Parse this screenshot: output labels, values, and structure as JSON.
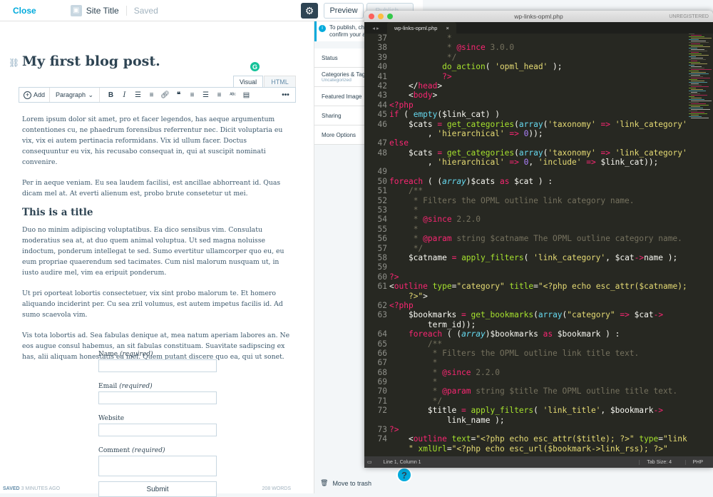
{
  "wp": {
    "close_label": "Close",
    "site_title": "Site Title",
    "saved_label": "Saved",
    "preview_label": "Preview",
    "publish_label": "Publish...",
    "post_title": "My first blog post.",
    "tab_visual": "Visual",
    "tab_html": "HTML",
    "toolbar": {
      "add_label": "Add",
      "paragraph_label": "Paragraph",
      "icons": [
        "bold-icon",
        "italic-icon",
        "unordered-list-icon",
        "ordered-list-icon",
        "link-icon",
        "quote-icon",
        "align-left-icon",
        "align-center-icon",
        "align-right-icon",
        "spellcheck-icon",
        "keyboard-icon",
        "more-icon"
      ]
    },
    "paragraphs": [
      "Lorem ipsum dolor sit amet, pro et facer legendos, has aeque argumentum contentiones cu, ne phaedrum forensibus referrentur nec. Dicit voluptaria eu vix, vix ei autem pertinacia reformidans. Vix id ullum facer. Doctus consequuntur eu vix, his recusabo consequat in, qui at suscipit nominati convenire.",
      "Per in aeque veniam. Eu sea laudem facilisi, est ancillae abhorreant id. Quas dicam mel at. At everti alienum est, probo brute consetetur ut mei."
    ],
    "heading": "This is a title",
    "paragraphs2": [
      "Duo no minim adipiscing voluptatibus. Ea dico sensibus vim. Consulatu moderatius sea at, at duo quem animal voluptua. Ut sed magna noluisse indoctum, ponderum intellegat te sed. Sumo evertitur ullamcorper quo eu, eu eum propriae quaerendum sed tacimates. Cum nisl malorum nusquam ut, in iusto audire mel, vim ea eripuit ponderum.",
      "Ut pri oporteat lobortis consectetuer, vix sint probo malorum te. Et homero aliquando inciderint per. Cu sea zril volumus, est autem impetus facilis id. Ad sumo scaevola vim.",
      "Vis tota lobortis ad. Sea fabulas denique at, mea natum aperiam labores an. Ne eos augue consul habemus, an sit fabulas constituam. Suavitate sadipscing ex has, alii aliquam honestatis ea mel. Quem putant discere quo ea, qui ut sonet."
    ],
    "form": {
      "name_label": "Name",
      "email_label": "Email",
      "website_label": "Website",
      "comment_label": "Comment",
      "required_text": "(required)",
      "submit_label": "Submit"
    },
    "status_saved": "SAVED",
    "status_time": "3 MINUTES AGO",
    "word_count": "208 WORDS",
    "sidebar": {
      "notice": "To publish, check\nconfirm your ad",
      "items": [
        {
          "label": "Status",
          "sub": ""
        },
        {
          "label": "Categories & Tags",
          "sub": "Uncategorized"
        },
        {
          "label": "Featured Image",
          "sub": ""
        },
        {
          "label": "Sharing",
          "sub": ""
        },
        {
          "label": "More Options",
          "sub": ""
        }
      ],
      "trash_label": "Move to trash",
      "help_label": "?"
    }
  },
  "sublime": {
    "file_name": "wp-links-opml.php",
    "unregistered": "UNREGISTERED",
    "tab_name": "wp-links-opml.php",
    "status_position": "Line 1, Column 1",
    "tab_size": "Tab Size: 4",
    "language": "PHP",
    "colors": {
      "bg": "#272822",
      "keyword": "#f92672",
      "function": "#a6e22e",
      "string": "#e6db74",
      "comment": "#75715e"
    },
    "lines": [
      {
        "n": "37",
        "html": "            <span class='c'>*</span>"
      },
      {
        "n": "38",
        "html": "            <span class='c'>* </span><span class='k'>@since</span><span class='c'> 3.0.0</span>"
      },
      {
        "n": "39",
        "html": "            <span class='c'>*/</span>"
      },
      {
        "n": "40",
        "html": "           <span class='f'>do_action</span>( <span class='s'>'opml_head'</span> );"
      },
      {
        "n": "41",
        "html": "           <span class='k'>?&gt;</span>"
      },
      {
        "n": "42",
        "html": "    &lt;/<span class='k'>head</span>&gt;"
      },
      {
        "n": "43",
        "html": "    &lt;<span class='k'>body</span>&gt;"
      },
      {
        "n": "44",
        "html": "<span class='k'>&lt;?php</span>"
      },
      {
        "n": "45",
        "html": "<span class='k'>if</span> ( <span class='t' style='font-style:normal;color:#66d9ef'>empty</span>($link_cat) )"
      },
      {
        "n": "46",
        "html": "    $cats <span class='k'>=</span> <span class='f'>get_categories</span>(<span class='t' style='font-style:normal;color:#66d9ef'>array</span>(<span class='s'>'taxonomy'</span> <span class='k'>=&gt;</span> <span class='s'>'link_category'</span>"
      },
      {
        "n": "",
        "html": "        , <span class='s'>'hierarchical'</span> <span class='k'>=&gt;</span> <span style='color:#ae81ff'>0</span>));"
      },
      {
        "n": "47",
        "html": "<span class='k'>else</span>"
      },
      {
        "n": "48",
        "html": "    $cats <span class='k'>=</span> <span class='f'>get_categories</span>(<span class='t' style='font-style:normal;color:#66d9ef'>array</span>(<span class='s'>'taxonomy'</span> <span class='k'>=&gt;</span> <span class='s'>'link_category'</span>"
      },
      {
        "n": "",
        "html": "        , <span class='s'>'hierarchical'</span> <span class='k'>=&gt;</span> <span style='color:#ae81ff'>0</span>, <span class='s'>'include'</span> <span class='k'>=&gt;</span> $link_cat));"
      },
      {
        "n": "49",
        "html": ""
      },
      {
        "n": "50",
        "html": "<span class='k'>foreach</span> ( (<span class='t'>array</span>)$cats <span class='k'>as</span> $cat ) :"
      },
      {
        "n": "51",
        "html": "    <span class='c'>/**</span>"
      },
      {
        "n": "52",
        "html": "     <span class='c'>* Filters the OPML outline link category name.</span>"
      },
      {
        "n": "53",
        "html": "     <span class='c'>*</span>"
      },
      {
        "n": "54",
        "html": "     <span class='c'>* </span><span class='k'>@since</span><span class='c'> 2.2.0</span>"
      },
      {
        "n": "55",
        "html": "     <span class='c'>*</span>"
      },
      {
        "n": "56",
        "html": "     <span class='c'>* </span><span class='k'>@param</span><span class='c'> string $catname The OPML outline category name.</span>"
      },
      {
        "n": "57",
        "html": "     <span class='c'>*/</span>"
      },
      {
        "n": "58",
        "html": "    $catname <span class='k'>=</span> <span class='f'>apply_filters</span>( <span class='s'>'link_category'</span>, $cat<span class='k'>-&gt;</span>name );"
      },
      {
        "n": "59",
        "html": ""
      },
      {
        "n": "60",
        "html": "<span class='k'>?&gt;</span>"
      },
      {
        "n": "61",
        "html": "&lt;<span class='k'>outline</span> <span class='a'>type</span>=<span class='s'>\"category\"</span> <span class='a'>title</span>=<span class='s'>\"&lt;?php echo esc_attr($catname);</span>"
      },
      {
        "n": "",
        "html": "    <span class='s'>?&gt;\"</span>&gt;"
      },
      {
        "n": "62",
        "html": "<span class='k'>&lt;?php</span>"
      },
      {
        "n": "63",
        "html": "    $bookmarks <span class='k'>=</span> <span class='f'>get_bookmarks</span>(<span class='t' style='font-style:normal;color:#66d9ef'>array</span>(<span class='s'>\"category\"</span> <span class='k'>=&gt;</span> $cat<span class='k'>-&gt;</span>"
      },
      {
        "n": "",
        "html": "        term_id));"
      },
      {
        "n": "64",
        "html": "    <span class='k'>foreach</span> ( (<span class='t'>array</span>)$bookmarks <span class='k'>as</span> $bookmark ) :"
      },
      {
        "n": "65",
        "html": "        <span class='c'>/**</span>"
      },
      {
        "n": "66",
        "html": "         <span class='c'>* Filters the OPML outline link title text.</span>"
      },
      {
        "n": "67",
        "html": "         <span class='c'>*</span>"
      },
      {
        "n": "68",
        "html": "         <span class='c'>* </span><span class='k'>@since</span><span class='c'> 2.2.0</span>"
      },
      {
        "n": "69",
        "html": "         <span class='c'>*</span>"
      },
      {
        "n": "70",
        "html": "         <span class='c'>* </span><span class='k'>@param</span><span class='c'> string $title The OPML outline title text.</span>"
      },
      {
        "n": "71",
        "html": "         <span class='c'>*/</span>"
      },
      {
        "n": "72",
        "html": "        $title <span class='k'>=</span> <span class='f'>apply_filters</span>( <span class='s'>'link_title'</span>, $bookmark<span class='k'>-&gt;</span>"
      },
      {
        "n": "",
        "html": "            link_name );"
      },
      {
        "n": "73",
        "html": "<span class='k'>?&gt;</span>"
      },
      {
        "n": "74",
        "html": "    &lt;<span class='k'>outline</span> <span class='a'>text</span>=<span class='s'>\"&lt;?php echo esc_attr($title); ?&gt;\"</span> <span class='a'>type</span>=<span class='s'>\"link</span>"
      },
      {
        "n": "",
        "html": "    <span class='s'>\"</span> <span class='a'>xmlUrl</span>=<span class='s'>\"&lt;?php echo esc_url($bookmark-&gt;link_rss); ?&gt;\"</span>"
      }
    ]
  }
}
